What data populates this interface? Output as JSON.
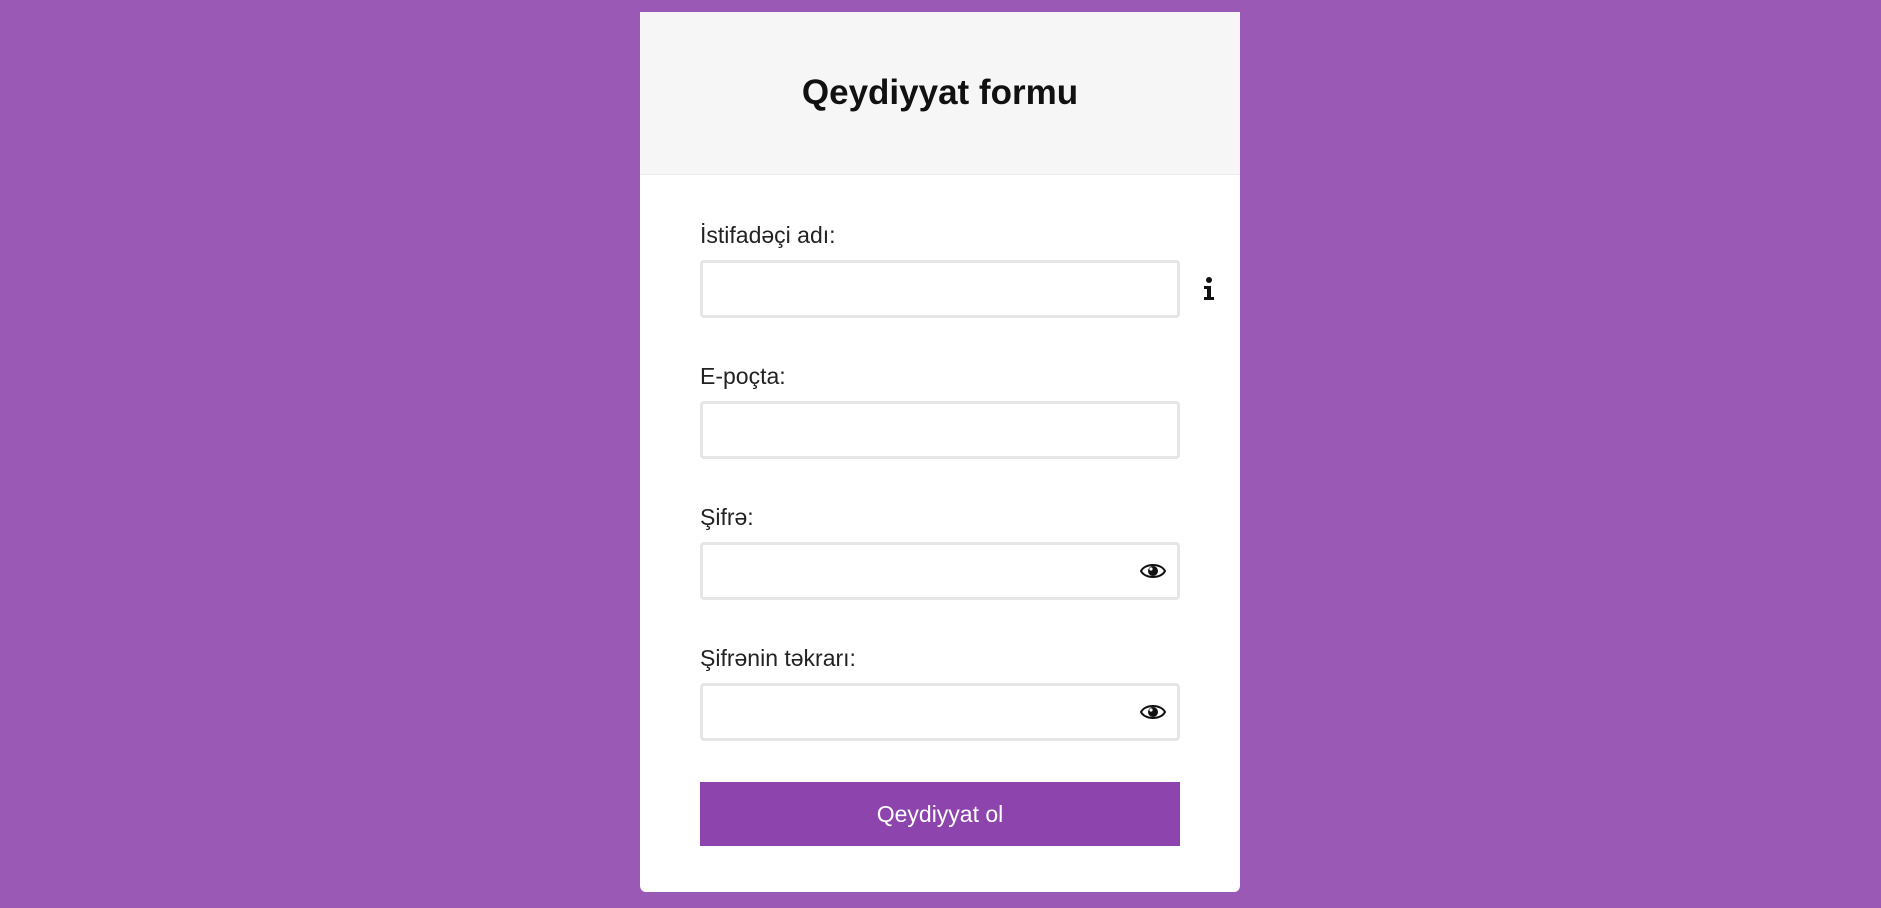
{
  "form": {
    "title": "Qeydiyyat formu",
    "fields": [
      {
        "label": "İstifadəçi adı:",
        "value": "",
        "icon": "info-icon"
      },
      {
        "label": "E-poçta:",
        "value": ""
      },
      {
        "label": "Şifrə:",
        "value": "",
        "icon": "eye-icon"
      },
      {
        "label": "Şifrənin təkrarı:",
        "value": "",
        "icon": "eye-icon"
      }
    ],
    "submit_label": "Qeydiyyat ol"
  },
  "colors": {
    "background": "#9b59b6",
    "button": "#8e44ad",
    "header": "#f6f6f6"
  }
}
